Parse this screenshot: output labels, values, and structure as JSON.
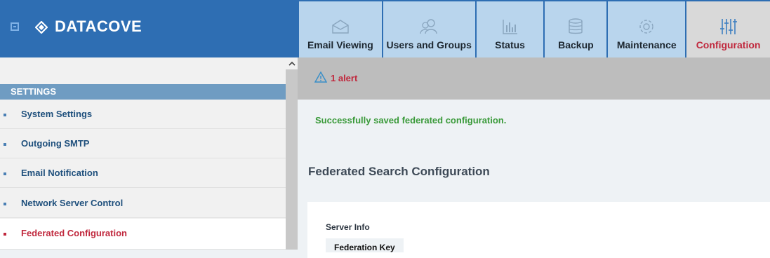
{
  "brand": {
    "name": "DATACOVE",
    "logo_icon": "diamond-logo-icon",
    "collapse_icon": "collapse-toggle-icon"
  },
  "tabs": [
    {
      "label": "Email Viewing",
      "icon": "envelope-icon"
    },
    {
      "label": "Users and Groups",
      "icon": "users-icon"
    },
    {
      "label": "Status",
      "icon": "bar-chart-icon"
    },
    {
      "label": "Backup",
      "icon": "database-icon"
    },
    {
      "label": "Maintenance",
      "icon": "gear-icon"
    },
    {
      "label": "Configuration",
      "icon": "sliders-icon",
      "active": true
    }
  ],
  "sidebar": {
    "section_title": "SETTINGS",
    "items": [
      {
        "label": "System Settings"
      },
      {
        "label": "Outgoing SMTP"
      },
      {
        "label": "Email Notification"
      },
      {
        "label": "Network Server Control"
      },
      {
        "label": "Federated Configuration",
        "active": true
      }
    ]
  },
  "main": {
    "alert": {
      "text": "1 alert",
      "icon": "warning-icon"
    },
    "success_message": "Successfully saved federated configuration.",
    "section_title": "Federated Search Configuration",
    "card": {
      "title": "Server Info",
      "field_label": "Federation Key"
    }
  },
  "colors": {
    "brand_blue": "#2e6eb3",
    "tab_bg": "#b9d5ed",
    "active_tab_bg": "#d9d9d9",
    "accent_red": "#c0283d",
    "success_green": "#3a9a3a",
    "sidebar_header": "#6f9cc2"
  }
}
